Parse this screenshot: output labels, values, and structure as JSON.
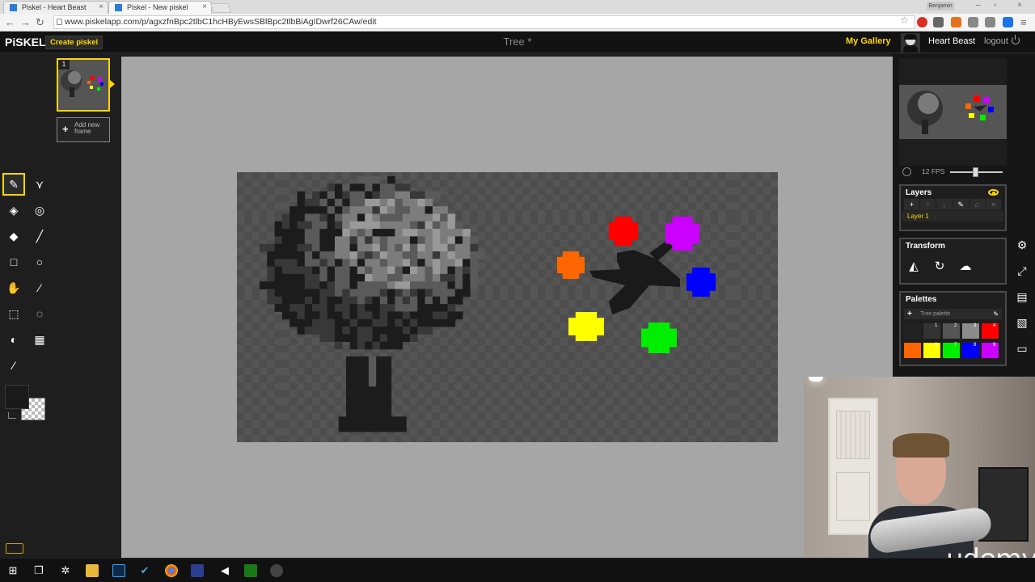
{
  "browser": {
    "tabs": [
      {
        "label": "Piskel - Heart Beast",
        "active": false
      },
      {
        "label": "Piskel - New piskel",
        "active": true
      }
    ],
    "profile_name": "Benjamin",
    "url": "www.piskelapp.com/p/agxzfnBpc2tlbC1hcHByEwsSBlBpc2tlbBiAgIDwrf26CAw/edit"
  },
  "app": {
    "logo": "PiSKEL",
    "create_button": "Create piskel",
    "document_title": "Tree *",
    "gallery_link": "My Gallery",
    "username": "Heart Beast",
    "logout": "logout",
    "accent_color": "#ffd700"
  },
  "frames": {
    "items": [
      {
        "number": "1"
      }
    ],
    "add_label_line1": "Add new",
    "add_label_line2": "frame"
  },
  "tools": [
    {
      "name": "pen-tool",
      "glyph": "✎",
      "selected": true
    },
    {
      "name": "vertical-mirror-pen-tool",
      "glyph": "⋎",
      "selected": false
    },
    {
      "name": "paint-bucket-tool",
      "glyph": "◈",
      "selected": false
    },
    {
      "name": "paint-same-pixels-tool",
      "glyph": "◎",
      "selected": false
    },
    {
      "name": "eraser-tool",
      "glyph": "◆",
      "selected": false
    },
    {
      "name": "stroke-tool",
      "glyph": "╱",
      "selected": false
    },
    {
      "name": "rectangle-tool",
      "glyph": "□",
      "selected": false
    },
    {
      "name": "circle-tool",
      "glyph": "○",
      "selected": false
    },
    {
      "name": "move-tool",
      "glyph": "✋",
      "selected": false
    },
    {
      "name": "shape-selection-tool",
      "glyph": "⁄",
      "selected": false
    },
    {
      "name": "rectangle-selection-tool",
      "glyph": "⬚",
      "selected": false
    },
    {
      "name": "lasso-selection-tool",
      "glyph": "◌",
      "selected": false
    },
    {
      "name": "lighten-tool",
      "glyph": "◐",
      "selected": false
    },
    {
      "name": "dithering-tool",
      "glyph": "▦",
      "selected": false
    },
    {
      "name": "color-picker-tool",
      "glyph": "⁄",
      "selected": false
    }
  ],
  "colors": {
    "primary": "#1a1a1a",
    "secondary": "transparent"
  },
  "animation": {
    "fps_label": "12 FPS",
    "fps_fraction": 0.45
  },
  "layers": {
    "title": "Layers",
    "items": [
      "Layer 1"
    ]
  },
  "transform": {
    "title": "Transform"
  },
  "palettes": {
    "title": "Palettes",
    "current": "Tree palette",
    "swatches": [
      {
        "n": "",
        "color": "#222222"
      },
      {
        "n": "1",
        "color": "#333333"
      },
      {
        "n": "2",
        "color": "#555555"
      },
      {
        "n": "3",
        "color": "#8c8c8c"
      },
      {
        "n": "4",
        "color": "#ff0000"
      },
      {
        "n": "",
        "color": "#ff6600"
      },
      {
        "n": "6",
        "color": "#ffff00"
      },
      {
        "n": "7",
        "color": "#00ee00"
      },
      {
        "n": "8",
        "color": "#0000ff"
      },
      {
        "n": "9",
        "color": "#cc00ff"
      }
    ]
  },
  "sprite": {
    "checker_light": "#555555",
    "checker_dark": "#4d4d4d",
    "shades": [
      "#1c1c1c",
      "#383838",
      "#5a5a5a",
      "#7c7c7c",
      "#999999"
    ],
    "blobs": [
      {
        "color": "#ff0000"
      },
      {
        "color": "#cc00ff"
      },
      {
        "color": "#ff6600"
      },
      {
        "color": "#0000ff"
      },
      {
        "color": "#ffff00"
      },
      {
        "color": "#00ee00"
      }
    ]
  },
  "watermark": "udemy"
}
